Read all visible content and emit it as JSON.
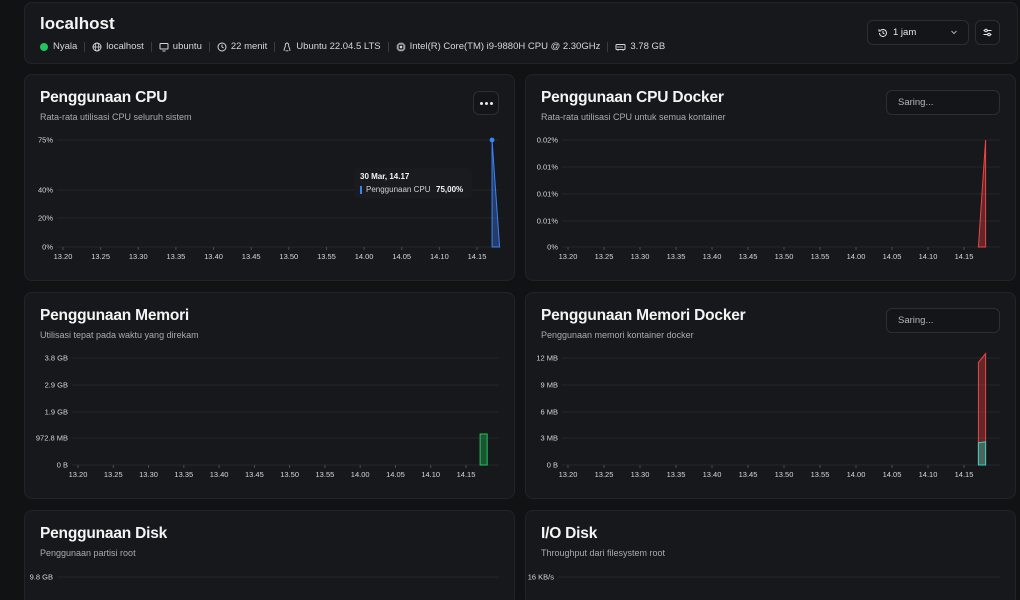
{
  "header": {
    "title": "localhost",
    "status": "Nyala",
    "status_color": "#22c55e",
    "items": [
      {
        "icon": "globe-icon",
        "text": "localhost"
      },
      {
        "icon": "monitor-icon",
        "text": "ubuntu"
      },
      {
        "icon": "clock-icon",
        "text": "22 menit"
      },
      {
        "icon": "linux-icon",
        "text": "Ubuntu 22.04.5 LTS"
      },
      {
        "icon": "cpu-icon",
        "text": "Intel(R) Core(TM) i9-9880H CPU @ 2.30GHz"
      },
      {
        "icon": "memory-icon",
        "text": "3.78 GB"
      }
    ],
    "time_range": "1 jam"
  },
  "time_ticks": [
    "13.20",
    "13.25",
    "13.30",
    "13.35",
    "13.40",
    "13.45",
    "13.50",
    "13.55",
    "14.00",
    "14.05",
    "14.10",
    "14.15"
  ],
  "cards": {
    "cpu": {
      "title": "Penggunaan CPU",
      "subtitle": "Rata-rata utilisasi CPU seluruh sistem",
      "tooltip": {
        "time": "30 Mar, 14.17",
        "series": "Penggunaan CPU",
        "value": "75,00%"
      }
    },
    "cpu_docker": {
      "title": "Penggunaan CPU Docker",
      "subtitle": "Rata-rata utilisasi CPU untuk semua kontainer",
      "filter_placeholder": "Saring..."
    },
    "memory": {
      "title": "Penggunaan Memori",
      "subtitle": "Utilisasi tepat pada waktu yang direkam"
    },
    "memory_docker": {
      "title": "Penggunaan Memori Docker",
      "subtitle": "Penggunaan memori kontainer docker",
      "filter_placeholder": "Saring..."
    },
    "disk": {
      "title": "Penggunaan Disk",
      "subtitle": "Penggunaan partisi root"
    },
    "disk_io": {
      "title": "I/O Disk",
      "subtitle": "Throughput dari filesystem root"
    }
  },
  "chart_data": [
    {
      "id": "cpu",
      "type": "area",
      "y_ticks": [
        "75%",
        "40%",
        "20%",
        "0%"
      ],
      "series": [
        {
          "color": "#3b82f6",
          "points": [
            [
              "14.17",
              75
            ],
            [
              "14.18",
              0
            ]
          ]
        }
      ]
    },
    {
      "id": "cpu_docker",
      "type": "area",
      "y_ticks": [
        "0.02%",
        "0.01%",
        "0.01%",
        "0.01%",
        "0%"
      ],
      "series": [
        {
          "color": "#ef4444",
          "points": [
            [
              "14.17",
              0
            ],
            [
              "14.18",
              0.02
            ]
          ]
        }
      ]
    },
    {
      "id": "memory",
      "type": "area",
      "y_ticks": [
        "3.8 GB",
        "2.9 GB",
        "1.9 GB",
        "972.8 MB",
        "0 B"
      ],
      "series": [
        {
          "color": "#22c55e",
          "points": [
            [
              "14.17",
              1.1
            ],
            [
              "14.18",
              1.1
            ]
          ]
        }
      ]
    },
    {
      "id": "memory_docker",
      "type": "area",
      "y_ticks": [
        "12 MB",
        "9 MB",
        "6 MB",
        "3 MB",
        "0 B"
      ],
      "series": [
        {
          "color": "#ef4444",
          "points": [
            [
              "14.17",
              11.5
            ],
            [
              "14.18",
              12.5
            ]
          ]
        },
        {
          "color": "#2dd4bf",
          "points": [
            [
              "14.17",
              2.5
            ],
            [
              "14.18",
              2.6
            ]
          ]
        }
      ]
    },
    {
      "id": "disk",
      "type": "area",
      "y_ticks": [
        "9.8 GB"
      ],
      "series": []
    },
    {
      "id": "disk_io",
      "type": "line",
      "y_ticks": [
        "16 KB/s"
      ],
      "series": [
        {
          "color": "#f59e0b",
          "points": []
        }
      ]
    }
  ]
}
